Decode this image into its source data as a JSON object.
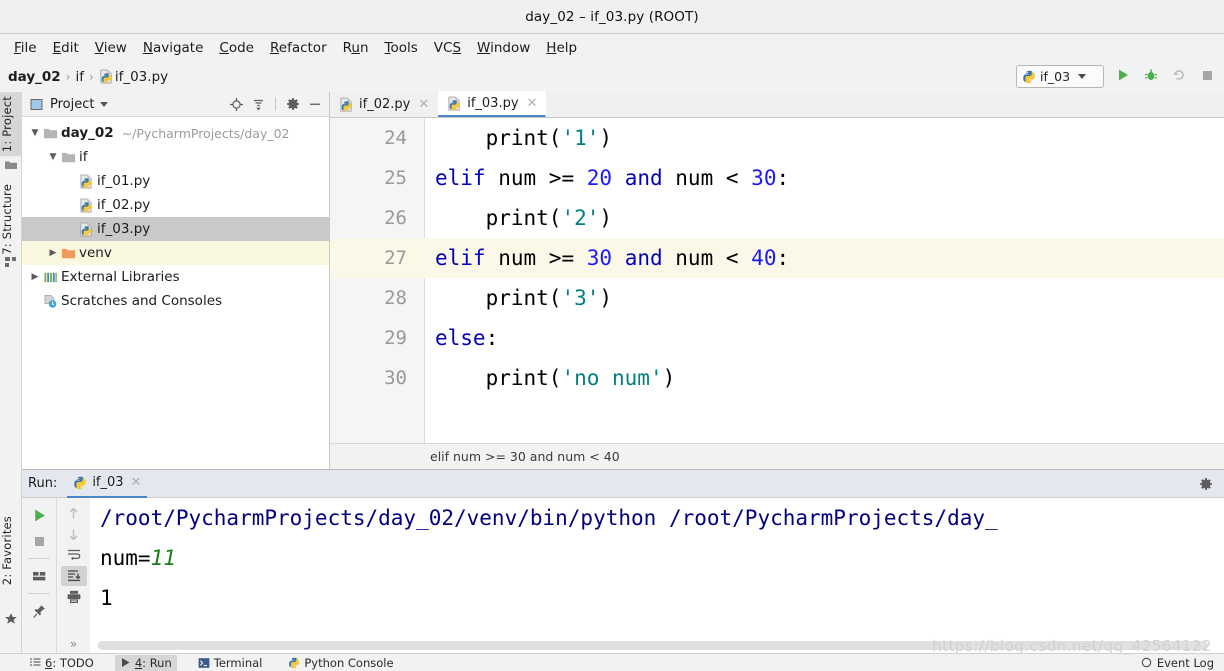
{
  "window": {
    "title": "day_02 – if_03.py (ROOT)"
  },
  "menubar": {
    "items": [
      {
        "label": "File",
        "mnemonic": "F"
      },
      {
        "label": "Edit",
        "mnemonic": "E"
      },
      {
        "label": "View",
        "mnemonic": "V"
      },
      {
        "label": "Navigate",
        "mnemonic": "N"
      },
      {
        "label": "Code",
        "mnemonic": "C"
      },
      {
        "label": "Refactor",
        "mnemonic": "R"
      },
      {
        "label": "Run",
        "mnemonic": "u"
      },
      {
        "label": "Tools",
        "mnemonic": "T"
      },
      {
        "label": "VCS",
        "mnemonic": "S"
      },
      {
        "label": "Window",
        "mnemonic": "W"
      },
      {
        "label": "Help",
        "mnemonic": "H"
      }
    ]
  },
  "navbar": {
    "crumbs": [
      "day_02",
      "if",
      "if_03.py"
    ],
    "separator": "›"
  },
  "run_config": {
    "name": "if_03",
    "icon": "python-icon",
    "buttons": [
      {
        "name": "run-button",
        "label": "Run"
      },
      {
        "name": "debug-button",
        "label": "Debug"
      },
      {
        "name": "rerun-button",
        "label": "Rerun"
      },
      {
        "name": "stop-button",
        "label": "Stop"
      }
    ]
  },
  "left_tool_strip": {
    "tabs": [
      {
        "label": "1: Project",
        "mnemonic": "1",
        "active": true,
        "icon": "folder-icon"
      },
      {
        "label": "7: Structure",
        "mnemonic": "7",
        "active": false,
        "icon": "structure-icon"
      },
      {
        "label": "2: Favorites",
        "mnemonic": "2",
        "active": false,
        "icon": "star-icon"
      }
    ]
  },
  "project_panel": {
    "title": "Project",
    "header_icons": [
      "locate-icon",
      "collapse-all-icon",
      "gear-icon",
      "minimize-icon"
    ],
    "tree": [
      {
        "label": "day_02",
        "path": "~/PycharmProjects/day_02",
        "icon": "folder-icon",
        "arrow": "▼",
        "depth": 0,
        "bold": true,
        "state": "normal"
      },
      {
        "label": "if",
        "path": "",
        "icon": "folder-icon",
        "arrow": "▼",
        "depth": 1,
        "bold": false,
        "state": "normal"
      },
      {
        "label": "if_01.py",
        "path": "",
        "icon": "python-file-icon",
        "arrow": "",
        "depth": 2,
        "bold": false,
        "state": "normal"
      },
      {
        "label": "if_02.py",
        "path": "",
        "icon": "python-file-icon",
        "arrow": "",
        "depth": 2,
        "bold": false,
        "state": "normal"
      },
      {
        "label": "if_03.py",
        "path": "",
        "icon": "python-file-icon",
        "arrow": "",
        "depth": 2,
        "bold": false,
        "state": "selected"
      },
      {
        "label": "venv",
        "path": "",
        "icon": "venv-folder-icon",
        "arrow": "▶",
        "depth": 1,
        "bold": false,
        "state": "highlight"
      },
      {
        "label": "External Libraries",
        "path": "",
        "icon": "library-icon",
        "arrow": "▶",
        "depth": 0,
        "bold": false,
        "state": "normal"
      },
      {
        "label": "Scratches and Consoles",
        "path": "",
        "icon": "scratches-icon",
        "arrow": "",
        "depth": 0,
        "bold": false,
        "state": "normal"
      }
    ]
  },
  "editor": {
    "tabs": [
      {
        "label": "if_02.py",
        "active": false,
        "icon": "python-file-icon"
      },
      {
        "label": "if_03.py",
        "active": true,
        "icon": "python-file-icon"
      }
    ],
    "current_line": 27,
    "lines": [
      {
        "num": "24",
        "tokens": [
          {
            "t": "    ",
            "c": "pl"
          },
          {
            "t": "print",
            "c": "fn"
          },
          {
            "t": "(",
            "c": "op"
          },
          {
            "t": "'1'",
            "c": "str"
          },
          {
            "t": ")",
            "c": "op"
          }
        ]
      },
      {
        "num": "25",
        "tokens": [
          {
            "t": "elif",
            "c": "kw"
          },
          {
            "t": " num ",
            "c": "pl"
          },
          {
            "t": ">=",
            "c": "op"
          },
          {
            "t": " ",
            "c": "pl"
          },
          {
            "t": "20",
            "c": "num"
          },
          {
            "t": " ",
            "c": "pl"
          },
          {
            "t": "and",
            "c": "kw"
          },
          {
            "t": " num ",
            "c": "pl"
          },
          {
            "t": "<",
            "c": "op"
          },
          {
            "t": " ",
            "c": "pl"
          },
          {
            "t": "30",
            "c": "num"
          },
          {
            "t": ":",
            "c": "op"
          }
        ]
      },
      {
        "num": "26",
        "tokens": [
          {
            "t": "    ",
            "c": "pl"
          },
          {
            "t": "print",
            "c": "fn"
          },
          {
            "t": "(",
            "c": "op"
          },
          {
            "t": "'2'",
            "c": "str"
          },
          {
            "t": ")",
            "c": "op"
          }
        ]
      },
      {
        "num": "27",
        "tokens": [
          {
            "t": "elif",
            "c": "kw"
          },
          {
            "t": " num ",
            "c": "pl"
          },
          {
            "t": ">=",
            "c": "op"
          },
          {
            "t": " ",
            "c": "pl"
          },
          {
            "t": "30",
            "c": "num"
          },
          {
            "t": " ",
            "c": "pl"
          },
          {
            "t": "and",
            "c": "kw"
          },
          {
            "t": " num ",
            "c": "pl"
          },
          {
            "t": "<",
            "c": "op"
          },
          {
            "t": " ",
            "c": "pl"
          },
          {
            "t": "40",
            "c": "num"
          },
          {
            "t": ":",
            "c": "op"
          }
        ]
      },
      {
        "num": "28",
        "tokens": [
          {
            "t": "    ",
            "c": "pl"
          },
          {
            "t": "print",
            "c": "fn"
          },
          {
            "t": "(",
            "c": "op"
          },
          {
            "t": "'3'",
            "c": "str"
          },
          {
            "t": ")",
            "c": "op"
          }
        ]
      },
      {
        "num": "29",
        "tokens": [
          {
            "t": "else",
            "c": "kw"
          },
          {
            "t": ":",
            "c": "op"
          }
        ]
      },
      {
        "num": "30",
        "tokens": [
          {
            "t": "    ",
            "c": "pl"
          },
          {
            "t": "print",
            "c": "fn"
          },
          {
            "t": "(",
            "c": "op"
          },
          {
            "t": "'no num'",
            "c": "str"
          },
          {
            "t": ")",
            "c": "op"
          }
        ]
      }
    ],
    "status_breadcrumb": "elif num >= 30 and num < 40"
  },
  "run_window": {
    "label": "Run:",
    "tab": {
      "label": "if_03",
      "icon": "python-icon"
    },
    "gear_icon": "gear-icon",
    "toolbar_left": [
      {
        "name": "rerun-button",
        "icon": "play-icon",
        "state": "enabled"
      },
      {
        "name": "stop-button",
        "icon": "stop-icon",
        "state": "disabled"
      },
      {
        "name": "layout-button",
        "icon": "layout-icon",
        "state": "enabled"
      },
      {
        "name": "pin-button",
        "icon": "pin-icon",
        "state": "enabled"
      }
    ],
    "toolbar_right": [
      {
        "name": "prev-occurrence-button",
        "icon": "arrow-up-icon",
        "state": "disabled"
      },
      {
        "name": "next-occurrence-button",
        "icon": "arrow-down-icon",
        "state": "disabled"
      },
      {
        "name": "soft-wrap-button",
        "icon": "soft-wrap-icon",
        "state": "enabled"
      },
      {
        "name": "scroll-to-end-button",
        "icon": "scroll-end-icon",
        "state": "active"
      },
      {
        "name": "print-button",
        "icon": "printer-icon",
        "state": "enabled"
      },
      {
        "name": "overflow-button",
        "icon": "chevron-right-double-icon",
        "state": "enabled"
      }
    ],
    "console": [
      {
        "segments": [
          {
            "t": "/root/PycharmProjects/day_02/venv/bin/python /root/PycharmProjects/day_",
            "c": "co-cmd"
          }
        ]
      },
      {
        "segments": [
          {
            "t": "num=",
            "c": "co-out"
          },
          {
            "t": "11",
            "c": "co-in"
          }
        ]
      },
      {
        "segments": [
          {
            "t": "1",
            "c": "co-out"
          }
        ]
      }
    ]
  },
  "statusbar": {
    "items": [
      {
        "label": "6: TODO",
        "mnemonic": "6",
        "icon": "todo-icon",
        "active": false
      },
      {
        "label": "4: Run",
        "mnemonic": "4",
        "icon": "run-icon",
        "active": true
      },
      {
        "label": "Terminal",
        "mnemonic": "",
        "icon": "terminal-icon",
        "active": false
      },
      {
        "label": "Python Console",
        "mnemonic": "",
        "icon": "python-icon",
        "active": false
      }
    ],
    "right": {
      "label": "Event Log",
      "icon": "event-log-icon"
    }
  },
  "watermark": {
    "text": "https://blog.csdn.net/qq_42564122"
  },
  "colors": {
    "accent": "#4a86c8",
    "keyword": "#0000c0",
    "string": "#008080",
    "number": "#1a1aff",
    "console_cmd": "#000080",
    "console_input": "#1a7f1a",
    "selection": "#c9c9c9",
    "current_line": "#fbf8e8"
  }
}
